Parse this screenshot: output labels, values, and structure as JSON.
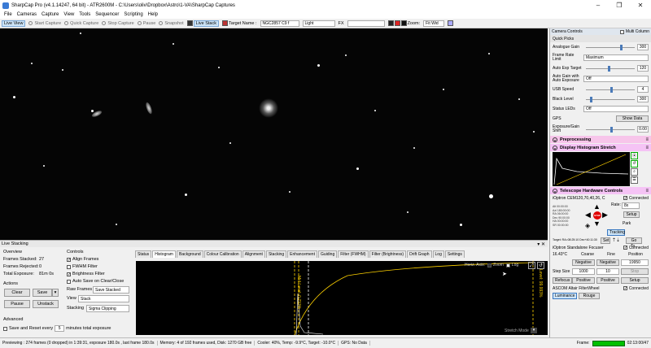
{
  "window": {
    "title": "SharpCap Pro (v4.1.14247, 64 bit) - ATR2600M - C:\\Users\\oliv\\Dropbox\\Astro\\1-VA\\SharpCap Captures"
  },
  "menu": [
    "File",
    "Cameras",
    "Capture",
    "View",
    "Tools",
    "Sequencer",
    "Scripting",
    "Help"
  ],
  "toolbar": {
    "live_view": "Live View",
    "start_capture": "Start Capture",
    "quick_capture": "Quick Capture",
    "stop_capture": "Stop Capture",
    "pause": "Pause",
    "snapshot": "Snapshot",
    "live_stack": "Live Stack",
    "target_label": "Target Name :",
    "target_value": "NGC2857 C9 f",
    "light": "Light",
    "fx": "FX",
    "zoom_label": "Zoom:",
    "zoom_value": "Fit Wid"
  },
  "camera_controls": {
    "title": "Camera Controls",
    "multi_column": "Multi Column",
    "quick_picks": "Quick Picks",
    "rows": [
      {
        "label": "Analogue Gain",
        "value": "300"
      },
      {
        "label": "Frame Rate Limit",
        "value": "Maximum"
      },
      {
        "label": "Auto Exp Target",
        "value": "120"
      },
      {
        "label": "Auto Gain with Auto Exposure",
        "value": "Off"
      },
      {
        "label": "USB Speed",
        "value": "4"
      },
      {
        "label": "Black Level",
        "value": "300"
      },
      {
        "label": "Status LEDs",
        "value": "Off"
      },
      {
        "label": "GPS",
        "value": "Show Data"
      },
      {
        "label": "Exposure/Gain Shift",
        "value": "0.00"
      }
    ],
    "preprocessing": "Preprocessing",
    "histogram_stretch": "Display Histogram Stretch",
    "telescope": "Telescope Hardware Controls",
    "mount_name": "iOptron CEM120,70,40,26, C",
    "connected": "Connected",
    "rate_label": "Rate:",
    "rate_value": "8x",
    "setup": "Setup",
    "park": "Park",
    "tracking": "Tracking",
    "goto": "Go To..",
    "set": "Set",
    "stop": "STOP",
    "mount_readout": [
      "Alt 00:00:00",
      "Azi 180:00:00",
      "RA 06:00:00",
      "Dec 90:00:00",
      "HA 00:00:00",
      "SR 00:00:00"
    ],
    "target_line": "Target: RA=08:25:10 Dec+40:11:30",
    "focuser_name": "iOptron Standalone Focuser",
    "temp": "16.43°C",
    "coarse": "Coarse",
    "fine": "Fine",
    "position": "Position",
    "negative": "Negative",
    "position_value": "19950",
    "step_size": "Step Size",
    "step_value": "1000",
    "step2": "10",
    "stop_btn": "Stop",
    "refocus": "Refocus",
    "positive": "Positive",
    "setup2": "Setup",
    "filter_wheel": "ASCOM Altair FilterWheel",
    "luminance": "Luminance",
    "rouge": "Rouge",
    "vert": "Vert",
    "bleu": "Bleu"
  },
  "live_stacking": {
    "title": "Live Stacking",
    "overview": "Overview",
    "frames_stacked_label": "Frames Stacked:",
    "frames_stacked": "27",
    "frames_rejected_label": "Frames Rejected:",
    "frames_rejected": "0",
    "total_exposure_label": "Total Exposure:",
    "total_exposure": "81m 0s",
    "actions": "Actions",
    "clear": "Clear",
    "save": "Save",
    "pause": "Pause",
    "unstack": "Unstack",
    "advanced": "Advanced",
    "save_reset": "Save and Reset every",
    "save_reset_value": "5",
    "minutes": "minutes total exposure",
    "controls": "Controls",
    "align_frames": "Align Frames",
    "fwhm_filter": "FWHM Filter",
    "brightness_filter": "Brightness Filter",
    "auto_save": "Auto Save on Clear/Close",
    "raw_frames_label": "Raw Frames",
    "raw_frames": "Save Stacked",
    "view_label": "View",
    "view": "Stack",
    "stacking_label": "Stacking",
    "stacking": "Sigma Clipping",
    "tabs": [
      "Status",
      "Histogram",
      "Background",
      "Colour Calibration",
      "Alignment",
      "Stacking",
      "Enhancement",
      "Guiding",
      "Filter (FWHM)",
      "Filter (Brightness)",
      "Drift Graph",
      "Log",
      "Settings"
    ],
    "horiz_axis": "Horiz. Axis:",
    "zoom": "Zoom",
    "log": "Log",
    "stretch_mode": "Stretch Mode",
    "marker1": "Mid Level: 0.212%",
    "marker2": "Level: 99.993%"
  },
  "status": {
    "preview": "Previewing : 274 frames (0 dropped) in 1:39:31, exposure 180.0s , last frame 180.0s",
    "memory": "Memory: 4 of 192 frames used, Disk: 1270 GB free",
    "cooler": "Cooler: 40%, Temp: -9.9°C, Target: -10.0°C",
    "gps": "GPS: No Data",
    "frame_label": "Frame:",
    "time": "02:13:00/47"
  },
  "colors": {
    "accent_green": "#00c000",
    "stretch_pink": "#f5c3f5",
    "preprocess_pink": "#f7c5ea",
    "telescope_pink": "#f5c3f5",
    "stop_red": "#e00000"
  }
}
